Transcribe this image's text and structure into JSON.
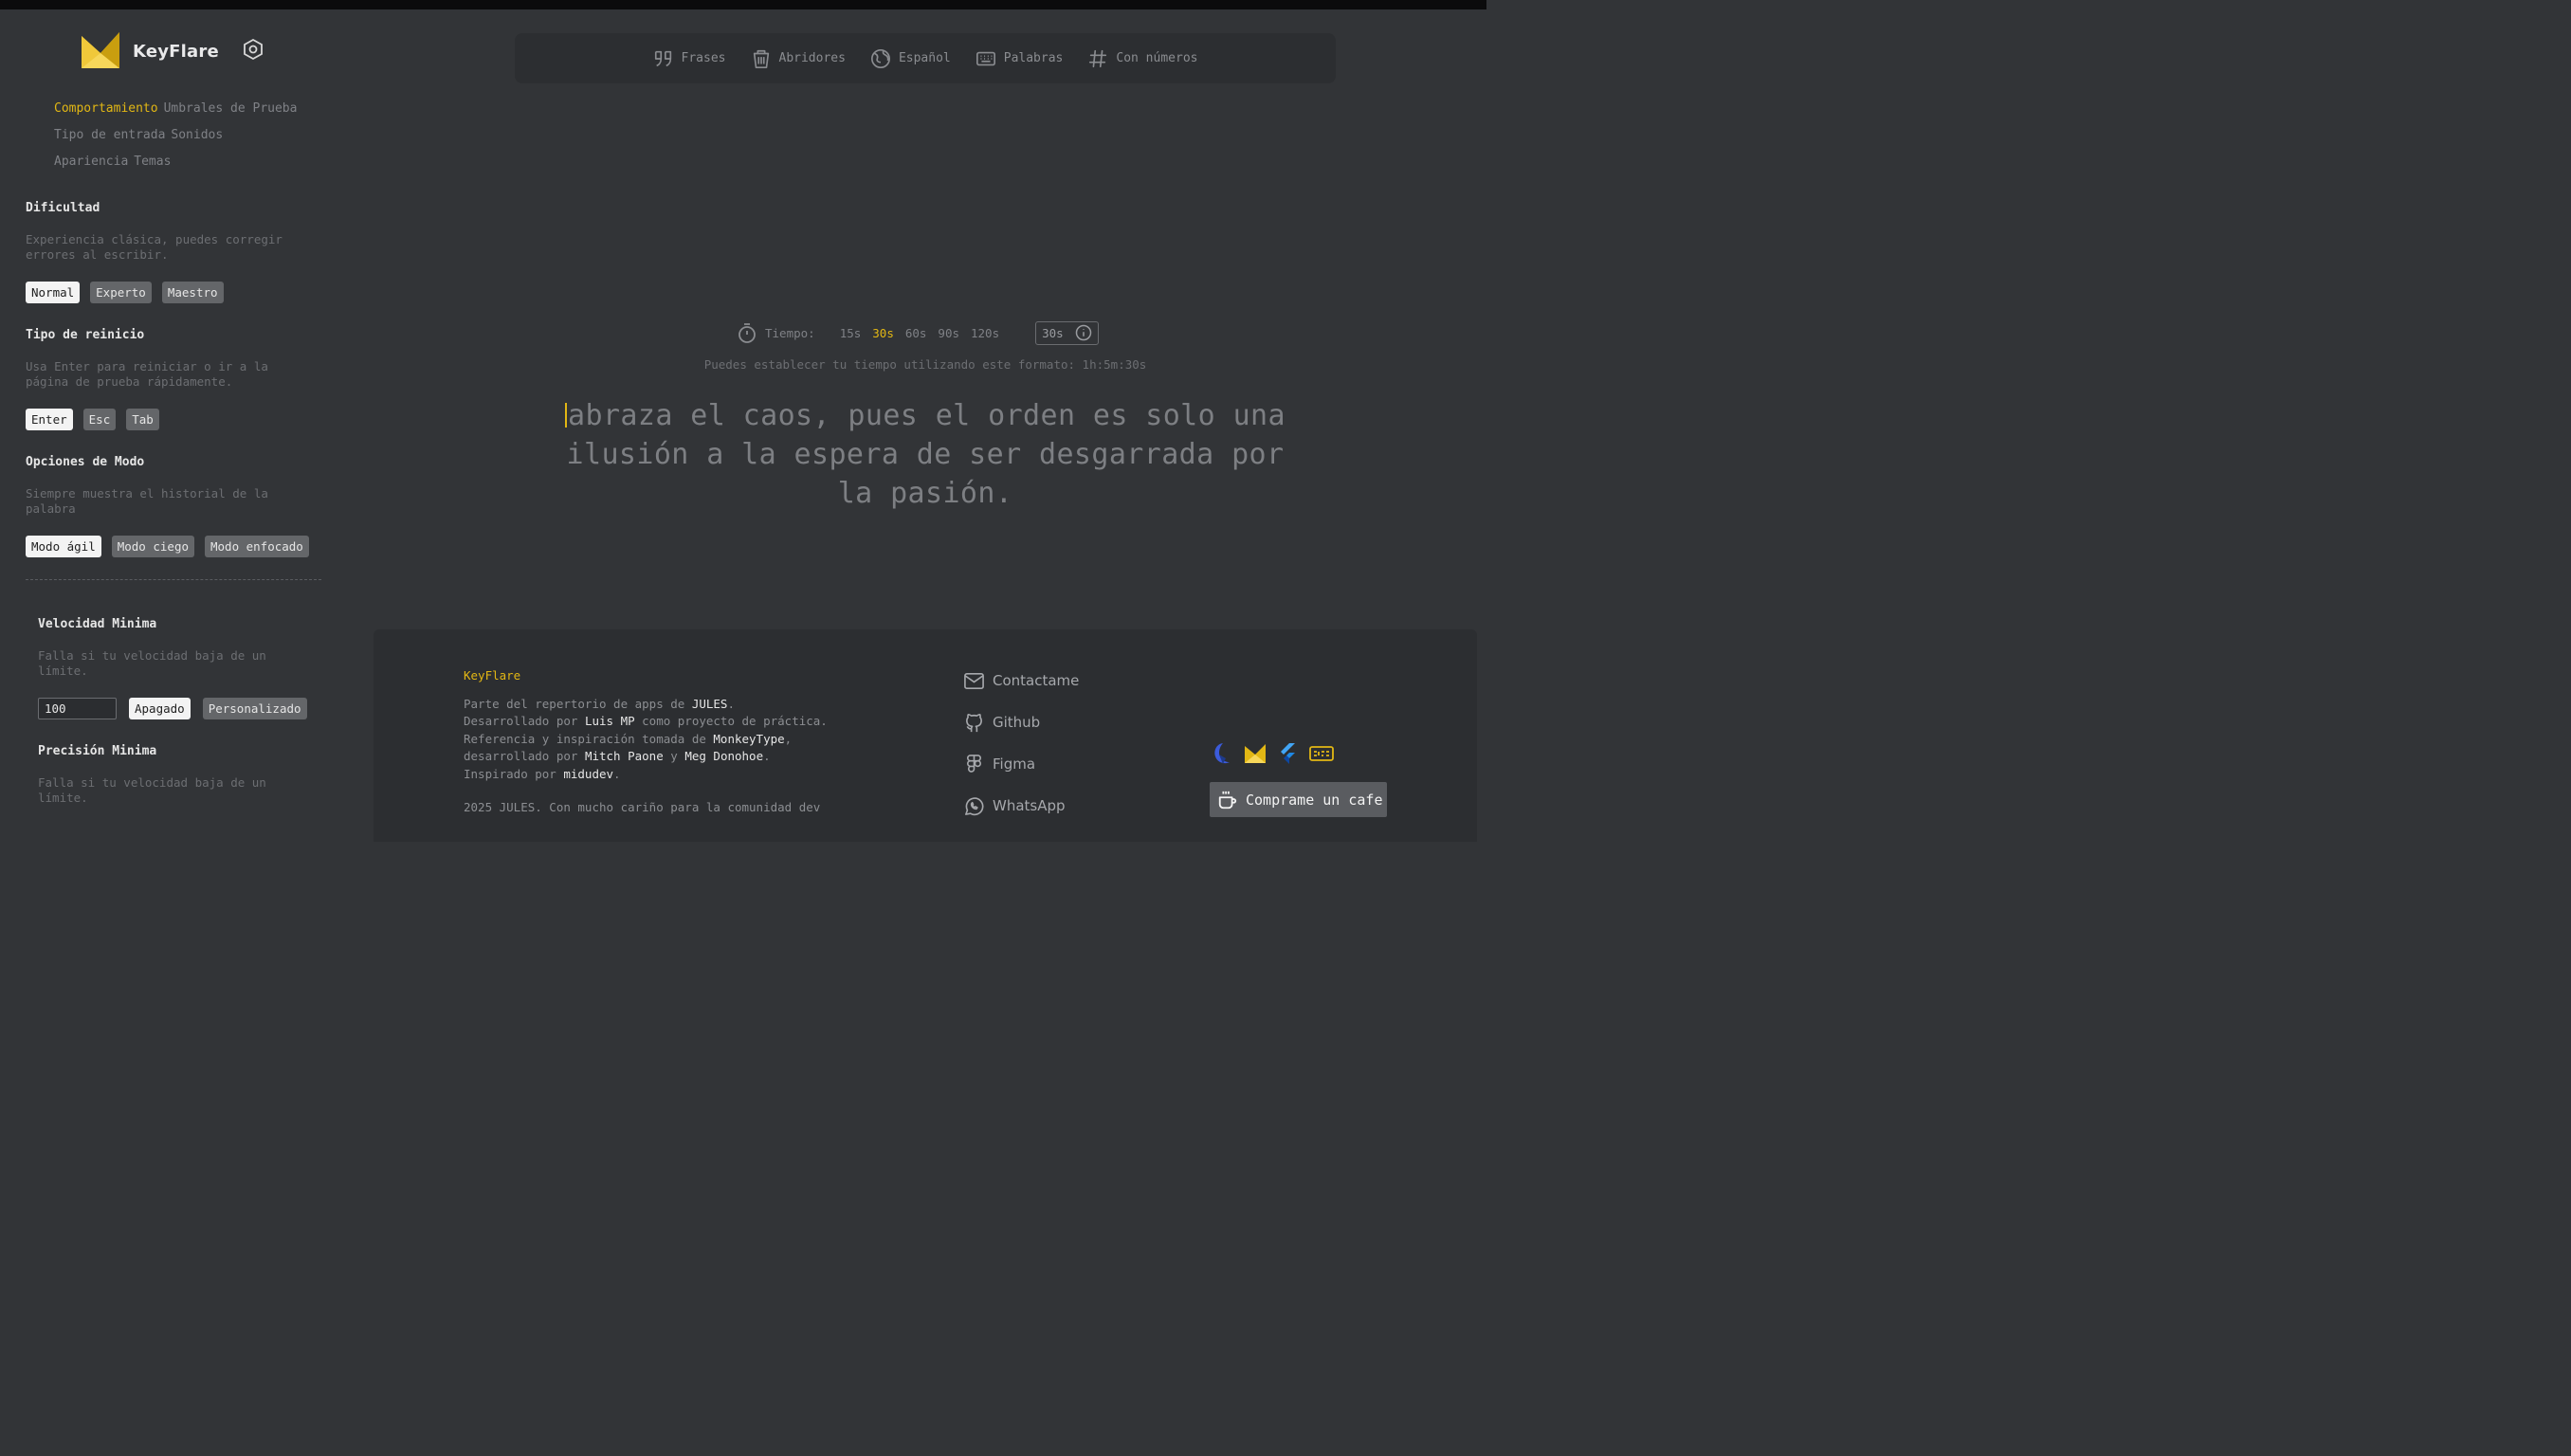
{
  "brand": {
    "name": "KeyFlare"
  },
  "nav": {
    "rows": [
      [
        {
          "label": "Comportamiento",
          "active": true
        },
        {
          "label": "Umbrales de Prueba"
        }
      ],
      [
        {
          "label": "Tipo de entrada"
        },
        {
          "label": "Sonidos"
        }
      ],
      [
        {
          "label": "Apariencia"
        },
        {
          "label": "Temas"
        }
      ]
    ]
  },
  "settings": {
    "difficulty": {
      "title": "Dificultad",
      "description": "Experiencia clásica, puedes corregir errores al escribir.",
      "options": [
        "Normal",
        "Experto",
        "Maestro"
      ],
      "selected": "Normal"
    },
    "restart": {
      "title": "Tipo de reinicio",
      "description": "Usa Enter para reiniciar o ir a la página de prueba rápidamente.",
      "options": [
        "Enter",
        "Esc",
        "Tab"
      ],
      "selected": "Enter"
    },
    "mode_options": {
      "title": "Opciones de Modo",
      "description": "Siempre muestra el historial de la palabra",
      "options": [
        "Modo ágil",
        "Modo ciego",
        "Modo enfocado"
      ],
      "selected": "Modo ágil"
    },
    "min_speed": {
      "title": "Velocidad Minima",
      "description": "Falla si tu velocidad baja de un límite.",
      "value": "100",
      "options": [
        "Apagado",
        "Personalizado"
      ],
      "selected": "Apagado"
    },
    "min_precision": {
      "title": "Precisión Minima",
      "description": "Falla si tu velocidad baja de un límite."
    }
  },
  "modes": [
    {
      "label": "Frases",
      "icon": "quote-icon"
    },
    {
      "label": "Abridores",
      "icon": "bucket-icon"
    },
    {
      "label": "Español",
      "icon": "globe-icon"
    },
    {
      "label": "Palabras",
      "icon": "keyboard-icon"
    },
    {
      "label": "Con números",
      "icon": "hash-icon"
    }
  ],
  "time": {
    "label": "Tiempo:",
    "options": [
      "15s",
      "30s",
      "60s",
      "90s",
      "120s"
    ],
    "active": "30s",
    "custom": "30s",
    "hint": "Puedes establecer tu tiempo utilizando este formato: 1h:5m:30s"
  },
  "words": "abraza el caos, pues el orden es solo una ilusión a la espera de ser desgarrada por la pasión.",
  "footer": {
    "title": "KeyFlare",
    "line1_pre": "Parte del repertorio de apps de ",
    "line1_hl": "JULES",
    "line1_post": ".",
    "line2_pre": "Desarrollado por ",
    "line2_hl": "Luis MP",
    "line2_post": " como proyecto de práctica.",
    "line3_pre": "Referencia y inspiración tomada de ",
    "line3_hl": "MonkeyType",
    "line3_post": ",",
    "line4_pre": "desarrollado por ",
    "line4_hl1": "Mitch Paone",
    "line4_mid": " y ",
    "line4_hl2": "Meg Donohoe",
    "line4_post": ".",
    "line5_pre": "Inspirado por ",
    "line5_hl": "midudev",
    "line5_post": ".",
    "copyright": "2025 JULES. Con mucho cariño para la comunidad dev",
    "links": [
      {
        "label": "Contactame",
        "icon": "mail-icon"
      },
      {
        "label": "Github",
        "icon": "github-icon"
      },
      {
        "label": "Figma",
        "icon": "figma-icon"
      },
      {
        "label": "WhatsApp",
        "icon": "whatsapp-icon"
      }
    ],
    "cafe_label": "Comprame un cafe"
  },
  "colors": {
    "accent": "#e2b714",
    "background": "#323437",
    "panel": "#2c2e31"
  }
}
